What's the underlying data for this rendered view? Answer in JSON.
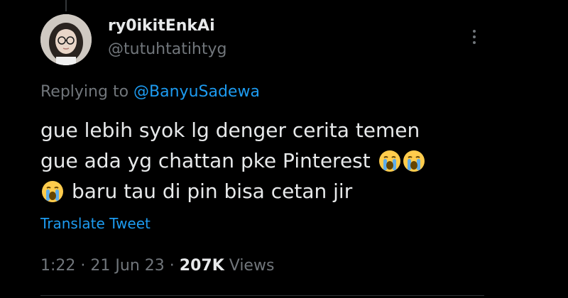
{
  "tweet": {
    "display_name": "ry0ikitEnkAi",
    "handle": "@tutuhtatihtyg",
    "replying_prefix": "Replying to",
    "replying_to": "@BanyuSadewa",
    "text_lines": [
      "gue lebih syok lg denger cerita temen",
      "gue ada yg chattan pke Pinterest",
      "baru tau di pin bisa cetan jir"
    ],
    "emoji": "crying-face-icon",
    "translate_label": "Translate Tweet",
    "time": "1:22",
    "date": "21 Jun 23",
    "separator": "·",
    "views_count": "207K",
    "views_label": "Views"
  },
  "colors": {
    "background": "#000000",
    "text": "#e7e9ea",
    "muted": "#71767b",
    "link": "#1d9bf0",
    "divider": "#2f3336"
  }
}
